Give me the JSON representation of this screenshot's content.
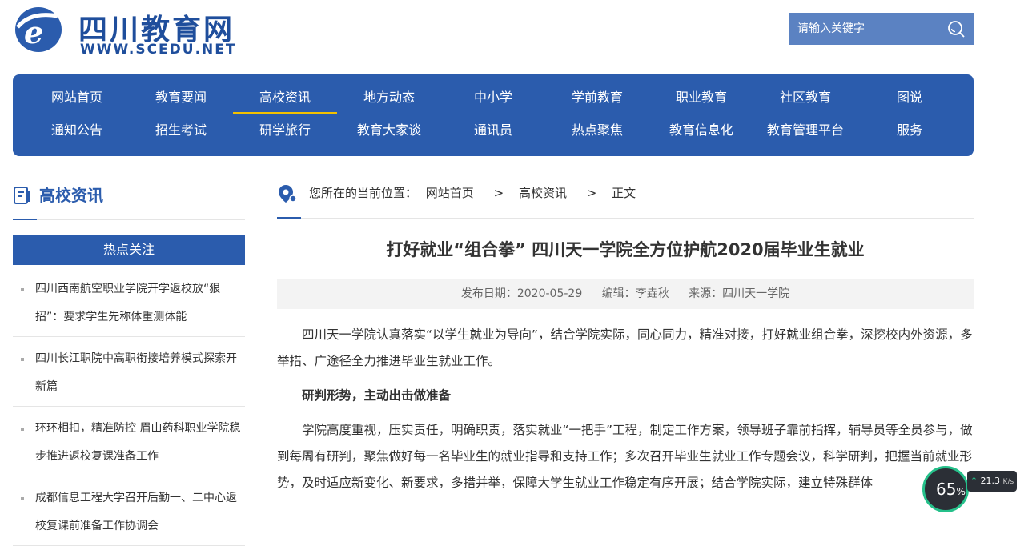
{
  "header": {
    "site_name": "四川教育网",
    "site_url": "WWW.SCEDU.NET",
    "search_placeholder": "请输入关键字"
  },
  "nav": {
    "row1": [
      "网站首页",
      "教育要闻",
      "高校资讯",
      "地方动态",
      "中小学",
      "学前教育",
      "职业教育",
      "社区教育",
      "图说"
    ],
    "row2": [
      "通知公告",
      "招生考试",
      "研学旅行",
      "教育大家谈",
      "通讯员",
      "热点聚焦",
      "教育信息化",
      "教育管理平台",
      "服务"
    ],
    "active": "高校资讯"
  },
  "sidebar": {
    "section_title": "高校资讯",
    "hot_title": "热点关注",
    "hot_items": [
      "四川西南航空职业学院开学返校放“狠招”：要求学生先称体重测体能",
      "四川长江职院中高职衔接培养模式探索开新篇",
      "环环相扣，精准防控 眉山药科职业学院稳步推进返校复课准备工作",
      "成都信息工程大学召开后勤一、二中心返校复课前准备工作协调会"
    ]
  },
  "breadcrumb": {
    "prefix": "您所在的当前位置：",
    "home": "网站首页",
    "section": "高校资讯",
    "current": "正文",
    "sep": ">"
  },
  "article": {
    "title": "打好就业“组合拳” 四川天一学院全方位护航2020届毕业生就业",
    "date": "发布日期：2020-05-29",
    "editor": "编辑：李垚秋",
    "source": "来源：四川天一学院",
    "p1": "四川天一学院认真落实“以学生就业为导向”，结合学院实际，同心同力，精准对接，打好就业组合拳，深挖校内外资源，多举措、广途径全力推进毕业生就业工作。",
    "sub1": "研判形势，主动出击做准备",
    "p2": "学院高度重视，压实责任，明确职责，落实就业“一把手”工程，制定工作方案，领导班子靠前指挥，辅导员等全员参与，做到每周有研判，聚焦做好每一名毕业生的就业指导和支持工作；多次召开毕业生就业工作专题会议，科学研判，把握当前就业形势，及时适应新变化、新要求，多措并举，保障大学生就业工作稳定有序开展；结合学院实际，建立特殊群体"
  },
  "widget": {
    "percent": "65",
    "percent_sign": "%",
    "speed": "21.3",
    "unit": "K/s",
    "arrow": "↑"
  },
  "colors": {
    "brand": "#2b5cad",
    "active_underline": "#f2c100",
    "search_bg": "#5b82c2"
  }
}
